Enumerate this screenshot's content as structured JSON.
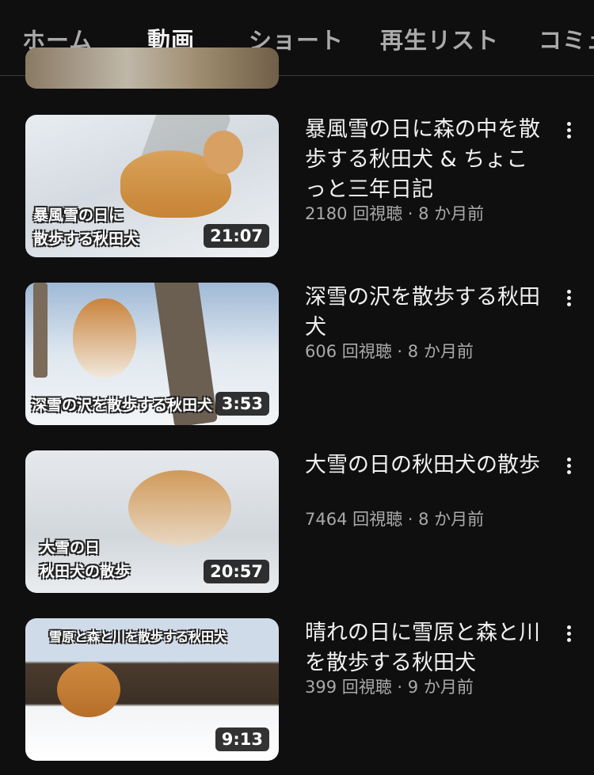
{
  "tabs": [
    {
      "label": "ホーム"
    },
    {
      "label": "動画"
    },
    {
      "label": "ショート"
    },
    {
      "label": "再生リスト"
    },
    {
      "label": "コミュ"
    }
  ],
  "active_tab": "動画",
  "videos": [
    {
      "caption": [
        "暴風雪の日に",
        "散歩する秋田犬"
      ],
      "duration": "21:07",
      "title": "暴風雪の日に森の中を散歩する秋田犬 & ちょこっと三年日記",
      "meta": "2180 回視聴 · 8 か月前"
    },
    {
      "caption": [
        "深雪の沢を散歩する秋田犬"
      ],
      "duration": "3:53",
      "title": "深雪の沢を散歩する秋田犬",
      "meta": "606 回視聴 · 8 か月前"
    },
    {
      "caption": [
        "大雪の日",
        "秋田犬の散歩"
      ],
      "duration": "20:57",
      "title": "大雪の日の秋田犬の散歩",
      "meta": "7464 回視聴 · 8 か月前"
    },
    {
      "caption": [
        "雪原と森と川を散歩する秋田犬"
      ],
      "duration": "9:13",
      "title": "晴れの日に雪原と森と川を散歩する秋田犬",
      "meta": "399 回視聴 · 9 か月前"
    }
  ],
  "icons": {
    "more": "more-vert-icon"
  }
}
